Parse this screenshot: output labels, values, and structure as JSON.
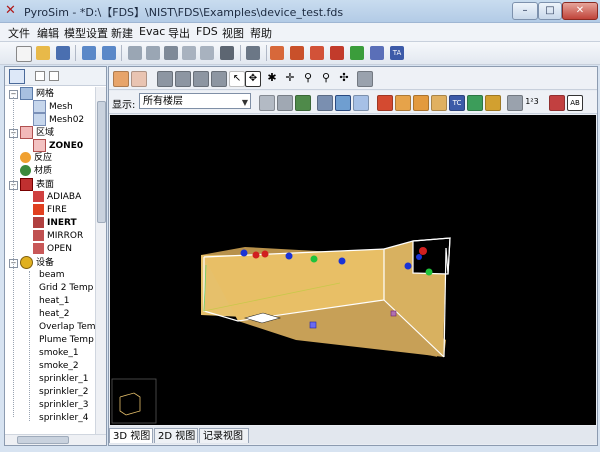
{
  "window": {
    "title": "PyroSim - *D:\\【FDS】\\NIST\\FDS\\Examples\\device_test.fds",
    "controls": {
      "minimize": "–",
      "maximize": "□",
      "close": "✕"
    }
  },
  "menu": [
    "文件",
    "编辑",
    "模型设置",
    "新建",
    "Evac",
    "导出",
    "FDS",
    "视图",
    "帮助"
  ],
  "tree": {
    "groups": [
      {
        "label": "网格",
        "icon": "mesh-group-icon",
        "children": [
          "Mesh",
          "Mesh02"
        ]
      },
      {
        "label": "区域",
        "icon": "zone-group-icon",
        "children": [
          "ZONE0"
        ]
      },
      {
        "label": "反应",
        "icon": "reaction-icon",
        "children": []
      },
      {
        "label": "材质",
        "icon": "material-icon",
        "children": []
      },
      {
        "label": "表面",
        "icon": "surface-group-icon",
        "children": [
          "ADIABA",
          "FIRE",
          "INERT",
          "MIRROR",
          "OPEN"
        ]
      },
      {
        "label": "设备",
        "icon": "device-group-icon",
        "children": [
          "beam",
          "Grid 2 Temp",
          "heat_1",
          "heat_2",
          "Overlap Tem",
          "Plume Temp",
          "smoke_1",
          "smoke_2",
          "sprinkler_1",
          "sprinkler_2",
          "sprinkler_3",
          "sprinkler_4"
        ]
      }
    ]
  },
  "display": {
    "label": "显示:",
    "floor_value": "所有楼层"
  },
  "view_tabs": [
    "3D 视图",
    "2D 视图",
    "记录视图"
  ],
  "colors": {
    "wall": "#e4b765",
    "wall_dark": "#9e7a32",
    "floor": "#c9a25a",
    "viewport_bg": "#000000",
    "accent_red": "#d02020",
    "accent_blue": "#2244dd"
  }
}
